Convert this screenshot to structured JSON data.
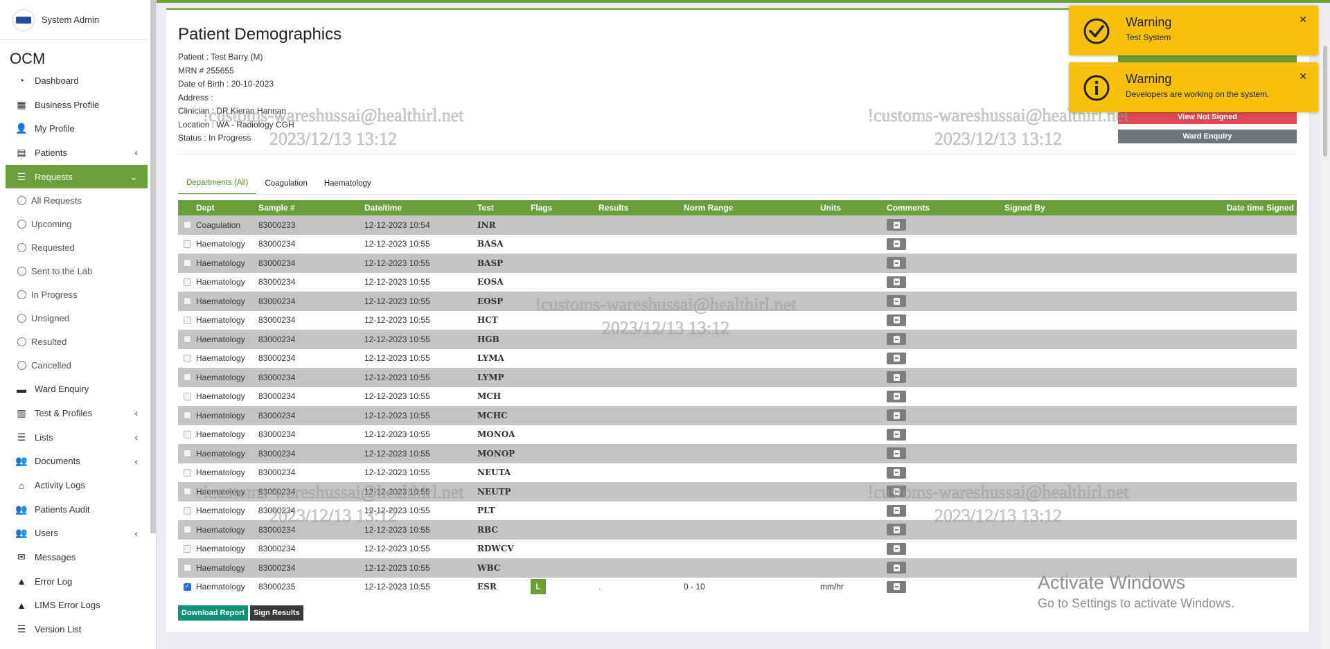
{
  "sidebar": {
    "username": "System Admin",
    "brand": "OCM",
    "items": [
      {
        "label": "Dashboard",
        "icon": "dashboard-icon",
        "glyph": "◔"
      },
      {
        "label": "Business Profile",
        "icon": "building-icon",
        "glyph": "▦"
      },
      {
        "label": "My Profile",
        "icon": "user-icon",
        "glyph": "👤"
      },
      {
        "label": "Patients",
        "icon": "patients-icon",
        "glyph": "▤",
        "chevron": "‹"
      },
      {
        "label": "Requests",
        "icon": "database-icon",
        "glyph": "☰",
        "chevron": "⌄"
      }
    ],
    "sub_items": [
      "All Requests",
      "Upcoming",
      "Requested",
      "Sent to the Lab",
      "In Progress",
      "Unsigned",
      "Resulted",
      "Cancelled"
    ],
    "items_after": [
      {
        "label": "Ward Enquiry",
        "icon": "bed-icon",
        "glyph": "▬"
      },
      {
        "label": "Test & Profiles",
        "icon": "vials-icon",
        "glyph": "▥",
        "chevron": "‹"
      },
      {
        "label": "Lists",
        "icon": "list-icon",
        "glyph": "☰",
        "chevron": "‹"
      },
      {
        "label": "Documents",
        "icon": "users-icon",
        "glyph": "👥",
        "chevron": "‹"
      },
      {
        "label": "Activity Logs",
        "icon": "bank-icon",
        "glyph": "⌂"
      },
      {
        "label": "Patients Audit",
        "icon": "users-icon",
        "glyph": "👥"
      },
      {
        "label": "Users",
        "icon": "users-icon",
        "glyph": "👥",
        "chevron": "‹"
      },
      {
        "label": "Messages",
        "icon": "envelope-icon",
        "glyph": "✉"
      },
      {
        "label": "Error Log",
        "icon": "warning-icon",
        "glyph": "▲"
      },
      {
        "label": "LIMS Error Logs",
        "icon": "warning-icon",
        "glyph": "▲"
      },
      {
        "label": "Version List",
        "icon": "list-icon",
        "glyph": "☰"
      }
    ]
  },
  "page": {
    "title": "Patient Demographics",
    "patient": "Patient : Test Barry (M)",
    "mrn": "MRN # 255655",
    "dob": "Date of Birth : 20-10-2023",
    "address": "Address :",
    "clinician": "Clinician : DR Kieran Hannan",
    "location": "Location : WA - Radiology CGH",
    "status": "Status : In Progress",
    "btn_view_not_signed": "View Not Signed",
    "btn_ward_enquiry": "Ward Enquiry"
  },
  "tabs": [
    "Departments (All)",
    "Coagulation",
    "Haematology"
  ],
  "table": {
    "headers": [
      "Dept",
      "Sample #",
      "Date/time",
      "Test",
      "Flags",
      "Results",
      "Norm Range",
      "Units",
      "Comments",
      "Signed By",
      "Date time Signed"
    ],
    "rows": [
      {
        "dept": "Coagulation",
        "sample": "83000233",
        "datetime": "12-12-2023 10:54",
        "test": "INR",
        "flags": "",
        "result": "",
        "norm": "",
        "units": "",
        "checked": false
      },
      {
        "dept": "Haematology",
        "sample": "83000234",
        "datetime": "12-12-2023 10:55",
        "test": "BASA",
        "flags": "",
        "result": "",
        "norm": "",
        "units": "",
        "checked": false
      },
      {
        "dept": "Haematology",
        "sample": "83000234",
        "datetime": "12-12-2023 10:55",
        "test": "BASP",
        "flags": "",
        "result": "",
        "norm": "",
        "units": "",
        "checked": false
      },
      {
        "dept": "Haematology",
        "sample": "83000234",
        "datetime": "12-12-2023 10:55",
        "test": "EOSA",
        "flags": "",
        "result": "",
        "norm": "",
        "units": "",
        "checked": false
      },
      {
        "dept": "Haematology",
        "sample": "83000234",
        "datetime": "12-12-2023 10:55",
        "test": "EOSP",
        "flags": "",
        "result": "",
        "norm": "",
        "units": "",
        "checked": false
      },
      {
        "dept": "Haematology",
        "sample": "83000234",
        "datetime": "12-12-2023 10:55",
        "test": "HCT",
        "flags": "",
        "result": "",
        "norm": "",
        "units": "",
        "checked": false
      },
      {
        "dept": "Haematology",
        "sample": "83000234",
        "datetime": "12-12-2023 10:55",
        "test": "HGB",
        "flags": "",
        "result": "",
        "norm": "",
        "units": "",
        "checked": false
      },
      {
        "dept": "Haematology",
        "sample": "83000234",
        "datetime": "12-12-2023 10:55",
        "test": "LYMA",
        "flags": "",
        "result": "",
        "norm": "",
        "units": "",
        "checked": false
      },
      {
        "dept": "Haematology",
        "sample": "83000234",
        "datetime": "12-12-2023 10:55",
        "test": "LYMP",
        "flags": "",
        "result": "",
        "norm": "",
        "units": "",
        "checked": false
      },
      {
        "dept": "Haematology",
        "sample": "83000234",
        "datetime": "12-12-2023 10:55",
        "test": "MCH",
        "flags": "",
        "result": "",
        "norm": "",
        "units": "",
        "checked": false
      },
      {
        "dept": "Haematology",
        "sample": "83000234",
        "datetime": "12-12-2023 10:55",
        "test": "MCHC",
        "flags": "",
        "result": "",
        "norm": "",
        "units": "",
        "checked": false
      },
      {
        "dept": "Haematology",
        "sample": "83000234",
        "datetime": "12-12-2023 10:55",
        "test": "MONOA",
        "flags": "",
        "result": "",
        "norm": "",
        "units": "",
        "checked": false
      },
      {
        "dept": "Haematology",
        "sample": "83000234",
        "datetime": "12-12-2023 10:55",
        "test": "MONOP",
        "flags": "",
        "result": "",
        "norm": "",
        "units": "",
        "checked": false
      },
      {
        "dept": "Haematology",
        "sample": "83000234",
        "datetime": "12-12-2023 10:55",
        "test": "NEUTA",
        "flags": "",
        "result": "",
        "norm": "",
        "units": "",
        "checked": false
      },
      {
        "dept": "Haematology",
        "sample": "83000234",
        "datetime": "12-12-2023 10:55",
        "test": "NEUTP",
        "flags": "",
        "result": "",
        "norm": "",
        "units": "",
        "checked": false
      },
      {
        "dept": "Haematology",
        "sample": "83000234",
        "datetime": "12-12-2023 10:55",
        "test": "PLT",
        "flags": "",
        "result": "",
        "norm": "",
        "units": "",
        "checked": false
      },
      {
        "dept": "Haematology",
        "sample": "83000234",
        "datetime": "12-12-2023 10:55",
        "test": "RBC",
        "flags": "",
        "result": "",
        "norm": "",
        "units": "",
        "checked": false
      },
      {
        "dept": "Haematology",
        "sample": "83000234",
        "datetime": "12-12-2023 10:55",
        "test": "RDWCV",
        "flags": "",
        "result": "",
        "norm": "",
        "units": "",
        "checked": false
      },
      {
        "dept": "Haematology",
        "sample": "83000234",
        "datetime": "12-12-2023 10:55",
        "test": "WBC",
        "flags": "",
        "result": "",
        "norm": "",
        "units": "",
        "checked": false
      },
      {
        "dept": "Haematology",
        "sample": "83000235",
        "datetime": "12-12-2023 10:55",
        "test": "ESR",
        "flags": "L",
        "result": ".",
        "norm": "0 - 10",
        "units": "mm/hr",
        "checked": true
      }
    ]
  },
  "buttons": {
    "download_report": "Download Report",
    "sign_results": "Sign Results"
  },
  "notifications": [
    {
      "title": "Warning",
      "message": "Test System",
      "icon": "check-circle-icon"
    },
    {
      "title": "Warning",
      "message": "Developers are working on the system.",
      "icon": "info-circle-icon"
    }
  ],
  "watermark": {
    "email": "!customs-wareshussai@healthirl.net",
    "timestamp": "2023/12/13 13:12"
  },
  "windows_activation": {
    "line1": "Activate Windows",
    "line2": "Go to Settings to activate Windows."
  },
  "colors": {
    "accent": "#6aa03a",
    "warning": "#f7c00a",
    "danger": "#e04a55",
    "secondary": "#6c757d",
    "teal": "#11907a"
  }
}
